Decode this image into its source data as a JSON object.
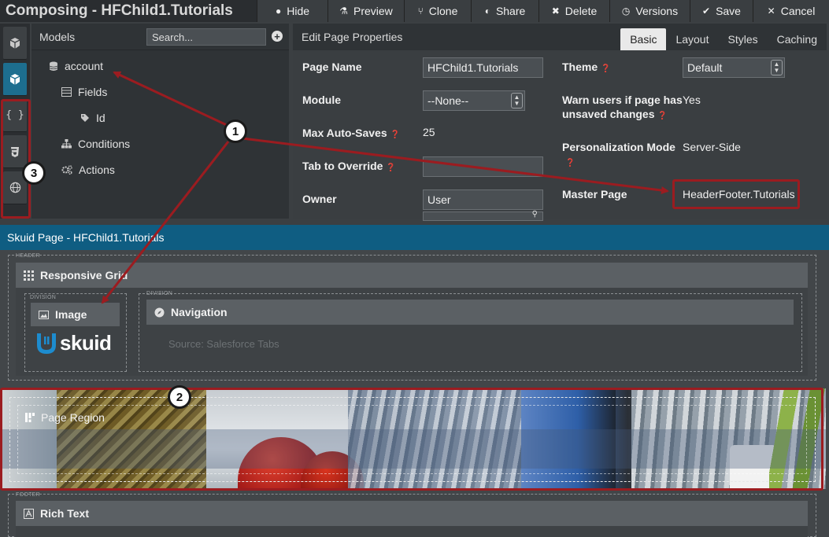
{
  "topbar": {
    "title": "Composing - HFChild1.Tutorials",
    "buttons": [
      {
        "label": "Hide",
        "icon": "●"
      },
      {
        "label": "Preview",
        "icon": "⚗"
      },
      {
        "label": "Clone",
        "icon": "⑂"
      },
      {
        "label": "Share",
        "icon": "◐"
      },
      {
        "label": "Delete",
        "icon": "✖"
      },
      {
        "label": "Versions",
        "icon": "◷"
      },
      {
        "label": "Save",
        "icon": "✔"
      },
      {
        "label": "Cancel",
        "icon": "✕"
      }
    ]
  },
  "rail": {
    "items": [
      "cube-outline-icon",
      "cube-icon",
      "braces-icon",
      "css3-icon",
      "globe-icon"
    ],
    "braces_glyph": "{ }"
  },
  "models": {
    "header": "Models",
    "search_placeholder": "Search...",
    "tree": [
      {
        "label": "account",
        "icon": "database-icon"
      },
      {
        "label": "Fields",
        "icon": "list-icon"
      },
      {
        "label": "Id",
        "icon": "tag-icon"
      },
      {
        "label": "Conditions",
        "icon": "sitemap-icon"
      },
      {
        "label": "Actions",
        "icon": "gears-icon"
      }
    ]
  },
  "properties": {
    "header": "Edit Page Properties",
    "tabs": [
      "Basic",
      "Layout",
      "Styles",
      "Caching"
    ],
    "active_tab": "Basic",
    "page_name_label": "Page Name",
    "page_name_value": "HFChild1.Tutorials",
    "module_label": "Module",
    "module_value": "--None--",
    "max_autosaves_label": "Max Auto-Saves",
    "max_autosaves_value": "25",
    "tab_override_label": "Tab to Override",
    "tab_override_value": "",
    "owner_label": "Owner",
    "owner_value": "User",
    "theme_label": "Theme",
    "theme_value": "Default",
    "warn_label_line1": "Warn users if page has",
    "warn_label_line2": "unsaved changes",
    "warn_value": "Yes",
    "personalization_label": "Personalization Mode",
    "personalization_value": "Server-Side",
    "master_page_label": "Master Page",
    "master_page_value": "HeaderFooter.Tutorials"
  },
  "canvas": {
    "title": "Skuid Page - HFChild1.Tutorials",
    "header_tag": "HEADER",
    "division_tag": "DIVISION",
    "grid_label": "Responsive Grid",
    "image_label": "Image",
    "logo_text": "skuid",
    "navigation_label": "Navigation",
    "navigation_source": "Source: Salesforce Tabs",
    "page_region_label": "Page Region",
    "footer_tag": "FOOTER",
    "rich_text_label": "Rich Text"
  },
  "callouts": [
    "1",
    "2",
    "3"
  ],
  "colors": {
    "accent_blue": "#0f5d82",
    "annotation_red": "#9b1c20",
    "active_rail": "#1d6e8f"
  }
}
